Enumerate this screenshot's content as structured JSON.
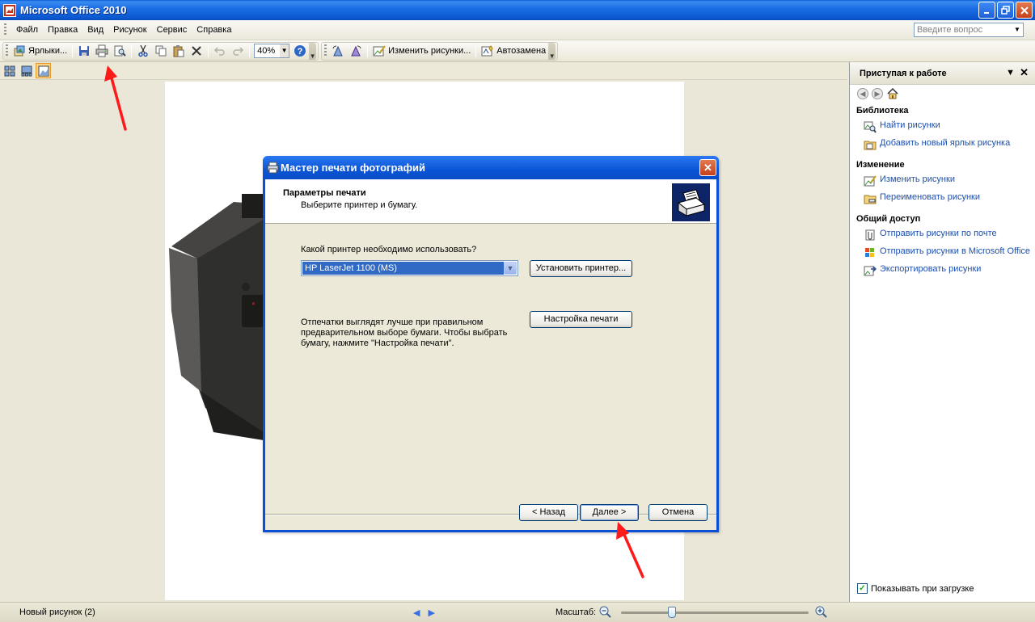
{
  "window": {
    "title": "Microsoft Office 2010"
  },
  "menu": {
    "items": [
      {
        "label": "Файл",
        "key": "file"
      },
      {
        "label": "Правка",
        "key": "edit"
      },
      {
        "label": "Вид",
        "key": "view"
      },
      {
        "label": "Рисунок",
        "key": "picture"
      },
      {
        "label": "Сервис",
        "key": "tools"
      },
      {
        "label": "Справка",
        "key": "help"
      }
    ],
    "ask_placeholder": "Введите вопрос"
  },
  "toolbar": {
    "shortcuts_label": "Ярлыки...",
    "zoom_value": "40%",
    "edit_pictures_label": "Изменить рисунки...",
    "autocorrect_label": "Автозамена"
  },
  "taskpane": {
    "title": "Приступая к работе",
    "sections": [
      {
        "title": "Библиотека",
        "links": [
          "Найти рисунки",
          "Добавить новый ярлык рисунка"
        ]
      },
      {
        "title": "Изменение",
        "links": [
          "Изменить рисунки",
          "Переименовать рисунки"
        ]
      },
      {
        "title": "Общий доступ",
        "links": [
          "Отправить рисунки по почте",
          "Отправить рисунки в Microsoft Office",
          "Экспортировать рисунки"
        ]
      }
    ],
    "show_on_startup_label": "Показывать при загрузке",
    "show_on_startup_checked": true
  },
  "dialog": {
    "title": "Мастер печати фотографий",
    "heading": "Параметры печати",
    "subheading": "Выберите принтер и бумагу.",
    "printer_question": "Какой принтер необходимо использовать?",
    "printer_selected": "HP LaserJet 1100 (MS)",
    "install_printer_label": "Установить принтер...",
    "note": "Отпечатки выглядят лучше при правильном предварительном выборе бумаги. Чтобы выбрать бумагу, нажмите \"Настройка печати\".",
    "print_setup_label": "Настройка печати",
    "back_label": "< Назад",
    "next_label": "Далее >",
    "cancel_label": "Отмена"
  },
  "statusbar": {
    "doc_name": "Новый рисунок (2)",
    "zoom_label": "Масштаб:",
    "zoom_level": 0.27
  },
  "colors": {
    "title_blue": "#0b58d0",
    "annotation_red": "#ff1a1a",
    "selection_blue": "#316ac5"
  }
}
